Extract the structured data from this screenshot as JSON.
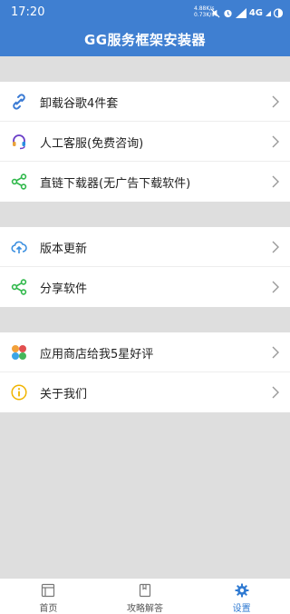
{
  "status": {
    "time": "17:20",
    "rate_down": "4.88K/s",
    "rate_up": "0.73K/s",
    "network": "4G"
  },
  "header": {
    "title": "GG服务框架安装器"
  },
  "groups": [
    {
      "items": [
        {
          "label": "卸载谷歌4件套",
          "icon": "link-icon"
        },
        {
          "label": "人工客服(免费咨询)",
          "icon": "headset-icon"
        },
        {
          "label": "直链下载器(无广告下载软件)",
          "icon": "share-icon"
        }
      ]
    },
    {
      "items": [
        {
          "label": "版本更新",
          "icon": "cloud-upload-icon"
        },
        {
          "label": "分享软件",
          "icon": "share-icon"
        }
      ]
    },
    {
      "items": [
        {
          "label": "应用商店给我5星好评",
          "icon": "petals-icon"
        },
        {
          "label": "关于我们",
          "icon": "info-icon"
        }
      ]
    }
  ],
  "tabs": [
    {
      "label": "首页",
      "icon": "home-icon",
      "active": false
    },
    {
      "label": "攻略解答",
      "icon": "guide-icon",
      "active": false
    },
    {
      "label": "设置",
      "icon": "gear-icon",
      "active": true
    }
  ],
  "colors": {
    "accent": "#3f7fd1",
    "active_tab": "#2f7ad2",
    "green": "#2fb84a",
    "background": "#dedede"
  }
}
